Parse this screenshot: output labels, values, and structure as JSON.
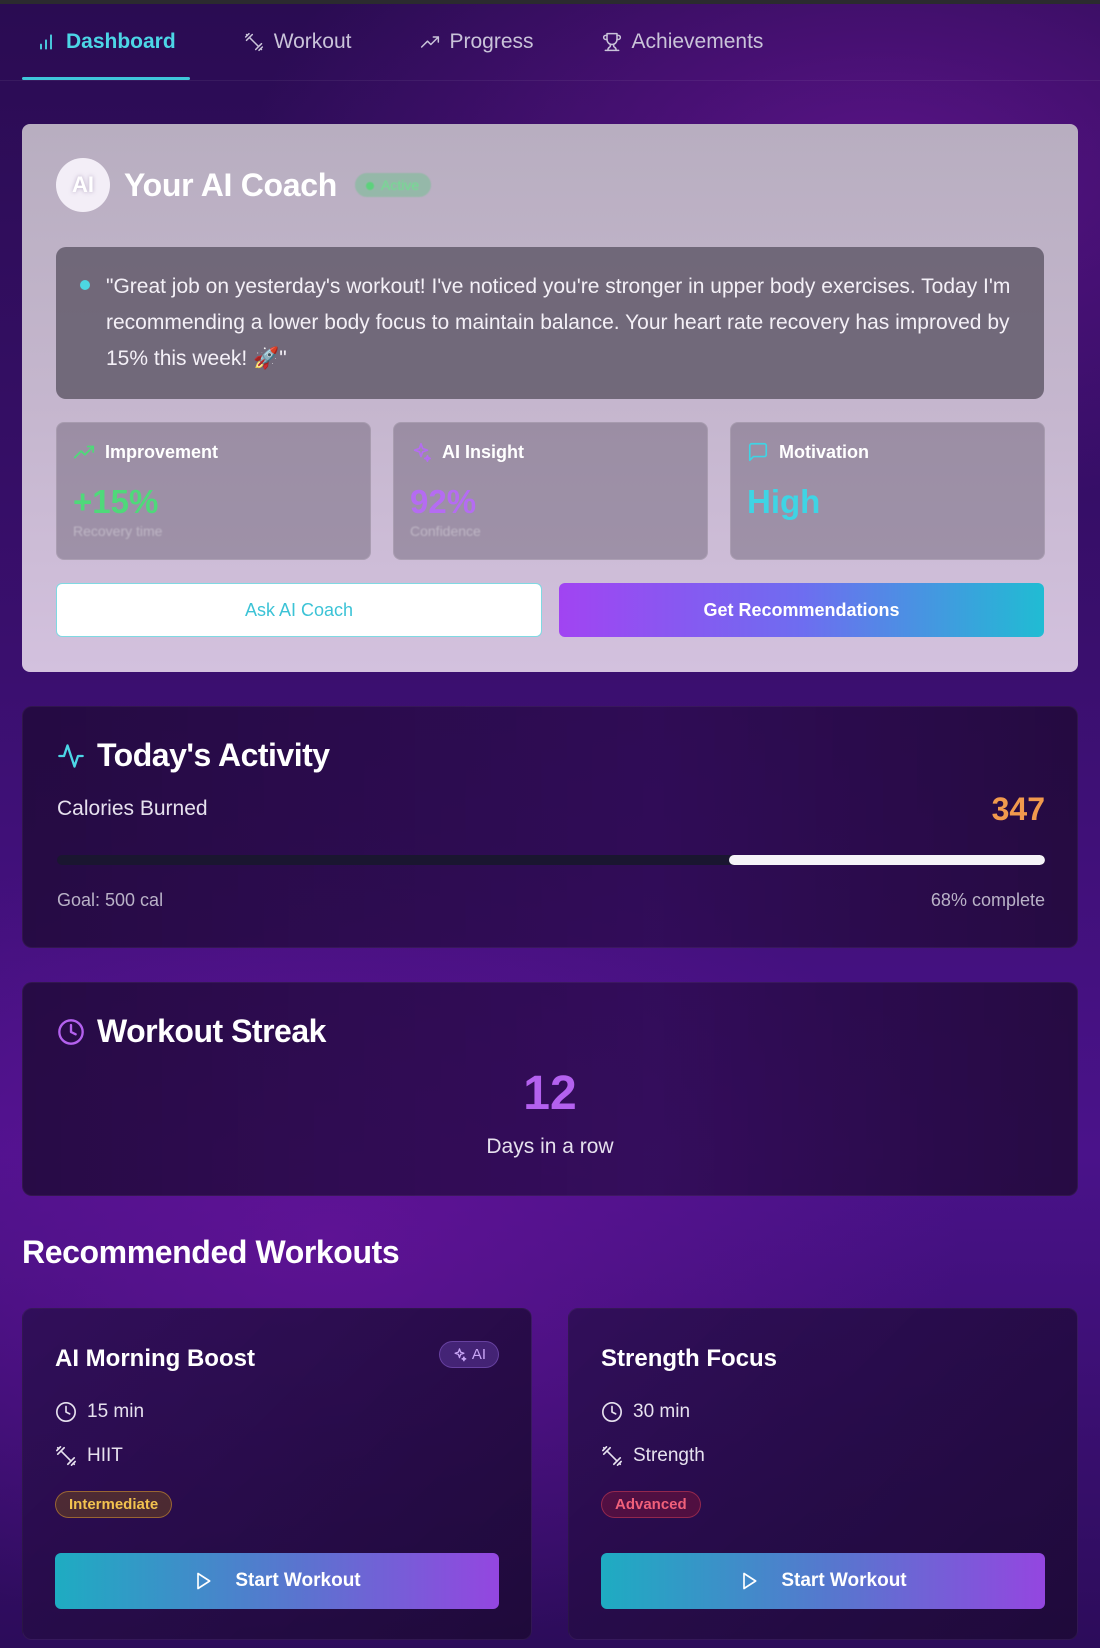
{
  "nav": {
    "tabs": [
      {
        "label": "Dashboard",
        "icon": "bar-chart-icon",
        "active": true
      },
      {
        "label": "Workout",
        "icon": "dumbbell-icon",
        "active": false
      },
      {
        "label": "Progress",
        "icon": "trending-up-icon",
        "active": false
      },
      {
        "label": "Achievements",
        "icon": "trophy-icon",
        "active": false
      }
    ]
  },
  "coach": {
    "avatar": "AI",
    "title": "Your AI Coach",
    "status": "Active",
    "message": "\"Great job on yesterday's workout! I've noticed you're stronger in upper body exercises. Today I'm recommending a lower body focus to maintain balance. Your heart rate recovery has improved by 15% this week! 🚀\"",
    "stats": [
      {
        "label": "Improvement",
        "value": "+15%",
        "sub": "Recovery time",
        "color": "#4fd97a",
        "icon": "trending-up-icon"
      },
      {
        "label": "AI Insight",
        "value": "92%",
        "sub": "Confidence",
        "color": "#b56cf2",
        "icon": "sparkles-icon"
      },
      {
        "label": "Motivation",
        "value": "High",
        "sub": "",
        "color": "#3fd4e4",
        "icon": "message-square-icon"
      }
    ],
    "ask_label": "Ask AI Coach",
    "recommend_label": "Get Recommendations"
  },
  "activity": {
    "title": "Today's Activity",
    "calories_label": "Calories Burned",
    "calories_value": "347",
    "progress": 0.32,
    "goal_text": "Goal: 500 cal",
    "percent_text": "68% complete"
  },
  "streak": {
    "title": "Workout Streak",
    "value": "12",
    "sub": "Days in a row"
  },
  "recommended": {
    "title": "Recommended Workouts",
    "workouts": [
      {
        "title": "AI Morning Boost",
        "badge": "AI",
        "duration": "15 min",
        "type": "HIIT",
        "level": "Intermediate",
        "button": "Start Workout"
      },
      {
        "title": "Strength Focus",
        "badge": "",
        "duration": "30 min",
        "type": "Strength",
        "level": "Advanced",
        "button": "Start Workout"
      }
    ]
  },
  "colors": {
    "accent_cyan": "#4cd6e6",
    "accent_purple": "#b461ef",
    "calories_orange": "#f19a4d"
  }
}
